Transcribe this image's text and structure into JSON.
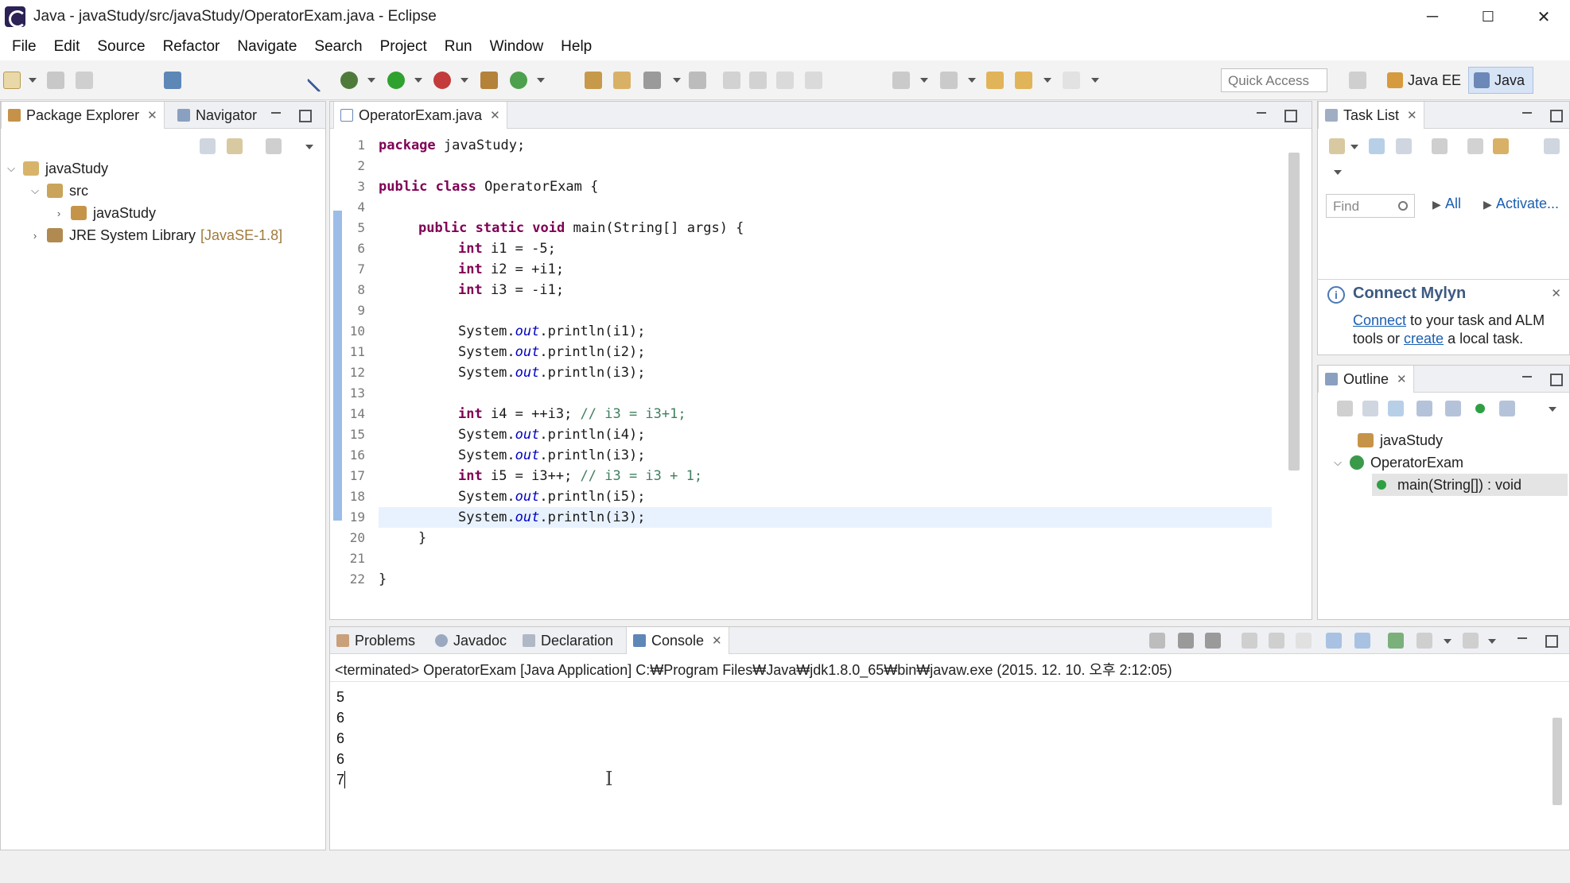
{
  "window": {
    "title": "Java - javaStudy/src/javaStudy/OperatorExam.java - Eclipse",
    "controls": {
      "minimize": "─",
      "maximize": "☐",
      "close": "✕"
    }
  },
  "menu": [
    "File",
    "Edit",
    "Source",
    "Refactor",
    "Navigate",
    "Search",
    "Project",
    "Run",
    "Window",
    "Help"
  ],
  "toolbar": {
    "quick_access_placeholder": "Quick Access",
    "perspectives": [
      {
        "label": "Java EE",
        "active": false
      },
      {
        "label": "Java",
        "active": true
      }
    ]
  },
  "left_panel": {
    "tabs": [
      "Package Explorer",
      "Navigator"
    ],
    "tree": [
      {
        "label": "javaStudy",
        "expanded": true,
        "level": 0
      },
      {
        "label": "src",
        "expanded": true,
        "level": 1
      },
      {
        "label": "javaStudy",
        "expanded": false,
        "level": 2
      },
      {
        "label": "JRE System Library",
        "suffix": "[JavaSE-1.8]",
        "expanded": false,
        "level": 1
      }
    ]
  },
  "editor": {
    "tab": "OperatorExam.java",
    "lines": [
      "1",
      "2",
      "3",
      "4",
      "5",
      "6",
      "7",
      "8",
      "9",
      "10",
      "11",
      "12",
      "13",
      "14",
      "15",
      "16",
      "17",
      "18",
      "19",
      "20",
      "21",
      "22"
    ],
    "code": {
      "l1_kw": "package",
      "l1_rest": " javaStudy;",
      "l3_kw": "public class",
      "l3_rest": " OperatorExam {",
      "l5_kw": "public static void",
      "l5_rest": " main(String[] args) {",
      "int_kw": "int",
      "l6_rest": " i1 = -5;",
      "l7_rest": " i2 = +i1;",
      "l8_rest": " i3 = -i1;",
      "sys": "System.",
      "out": "out",
      "l10_rest": ".println(i1);",
      "l11_rest": ".println(i2);",
      "l12_rest": ".println(i3);",
      "l14_rest": " i4 = ++i3; ",
      "l14_cm": "// i3 = i3+1;",
      "l15_rest": ".println(i4);",
      "l16_rest": ".println(i3);",
      "l17_rest": " i5 = i3++; ",
      "l17_cm": "// i3 = i3 + 1;",
      "l18_rest": ".println(i5);",
      "l19_rest": ".println(i3);",
      "l20": "}",
      "l22": "}"
    }
  },
  "task_list": {
    "tab": "Task List",
    "find_placeholder": "Find",
    "all_label": "All",
    "activate_label": "Activate..."
  },
  "mylyn": {
    "title": "Connect Mylyn",
    "connect_link": "Connect",
    "text1": " to your task and ALM",
    "text2": "tools or ",
    "create_link": "create",
    "text3": " a local task."
  },
  "outline": {
    "tab": "Outline",
    "items": [
      "javaStudy",
      "OperatorExam",
      "main(String[]) : void"
    ]
  },
  "bottom_panel": {
    "tabs": [
      "Problems",
      "Javadoc",
      "Declaration",
      "Console"
    ],
    "status_line": "<terminated> OperatorExam [Java Application] C:₩Program Files₩Java₩jdk1.8.0_65₩bin₩javaw.exe (2015. 12. 10. 오후 2:12:05)",
    "output": [
      "5",
      "6",
      "6",
      "6",
      "7"
    ]
  },
  "colors": {
    "keyword": "#7f0055",
    "field": "#0000c0",
    "comment": "#3f7f5f",
    "link": "#1b5fb0"
  }
}
